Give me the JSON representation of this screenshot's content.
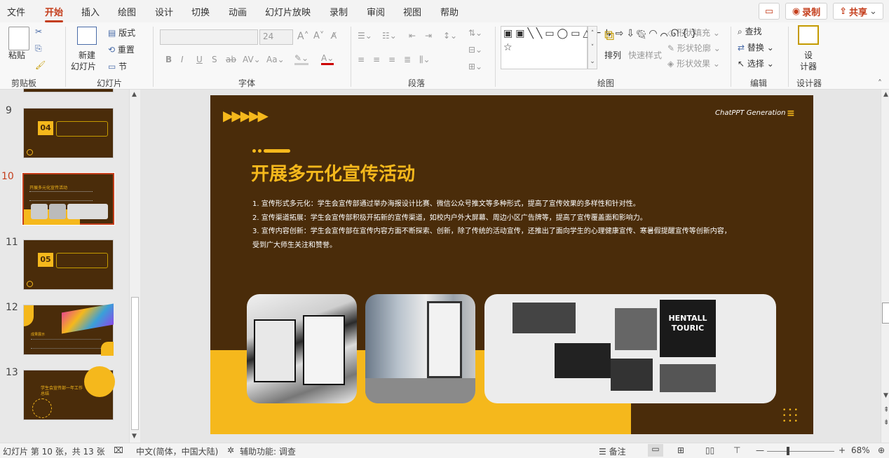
{
  "tabs": [
    "文件",
    "开始",
    "插入",
    "绘图",
    "设计",
    "切换",
    "动画",
    "幻灯片放映",
    "录制",
    "审阅",
    "视图",
    "帮助"
  ],
  "active_tab": "开始",
  "top_buttons": {
    "comment_icon": "comment-icon",
    "record": "录制",
    "share": "共享"
  },
  "ribbon": {
    "clipboard": {
      "paste": "粘贴",
      "label": "剪贴板"
    },
    "slides": {
      "new_slide": "新建",
      "new_slide2": "幻灯片",
      "layout": "版式",
      "reset": "重置",
      "section": "节",
      "label": "幻灯片"
    },
    "font": {
      "size": "24",
      "label": "字体",
      "bold": "B",
      "italic": "I",
      "underline": "U",
      "strike": "S",
      "shadow": "ab"
    },
    "paragraph": {
      "label": "段落"
    },
    "drawing": {
      "arrange": "排列",
      "quick_styles": "快速样式",
      "shape_fill": "形状填充",
      "shape_outline": "形状轮廓",
      "shape_effects": "形状效果",
      "label": "绘图"
    },
    "editing": {
      "find": "查找",
      "replace": "替换",
      "select": "选择",
      "label": "编辑"
    },
    "designer": {
      "design1": "设",
      "design2": "计器",
      "label": "设计器"
    }
  },
  "thumbnails": [
    {
      "num": "9",
      "tag": "04",
      "selected": false
    },
    {
      "num": "10",
      "title": "开展多元化宣传活动",
      "selected": true
    },
    {
      "num": "11",
      "tag": "05",
      "selected": false
    },
    {
      "num": "12",
      "title": "成果展示",
      "selected": false
    },
    {
      "num": "13",
      "title": "学生会宣传部一年工作总结",
      "selected": false
    }
  ],
  "slide": {
    "brand": "ChatPPT Generation",
    "title": "开展多元化宣传活动",
    "points": [
      "1. 宣传形式多元化：学生会宣传部通过举办海报设计比赛、微信公众号推文等多种形式，提高了宣传效果的多样性和针对性。",
      "2. 宣传渠道拓展：学生会宣传部积极开拓新的宣传渠道，如校内户外大屏幕、周边小区广告牌等，提高了宣传覆盖面和影响力。",
      "3. 宣传内容创新：学生会宣传部在宣传内容方面不断探索、创新，除了传统的活动宣传，还推出了面向学生的心理健康宣传、寒暑假提醒宣传等创新内容，",
      "受到广大师生关注和赞誉。"
    ],
    "photo3_text1": "HENTALL",
    "photo3_text2": "TOURIC"
  },
  "status": {
    "slide_info": "幻灯片 第 10 张，共 13 张",
    "language": "中文(简体，中国大陆)",
    "accessibility": "辅助功能: 调查",
    "notes": "备注",
    "zoom": "68%"
  },
  "colors": {
    "accent": "#c43e1c",
    "slide_bg": "#4a2c0a",
    "slide_yellow": "#f5b81c"
  }
}
